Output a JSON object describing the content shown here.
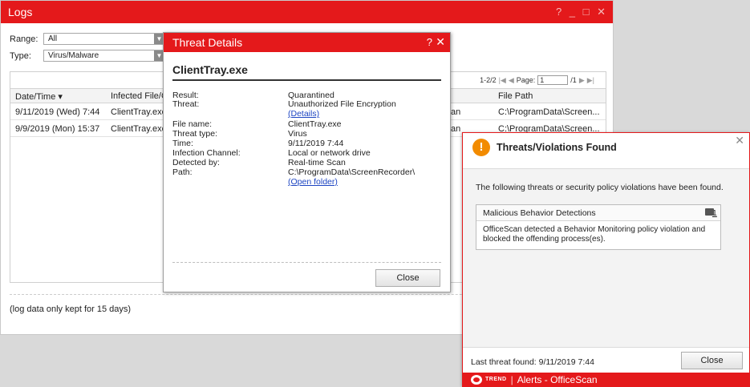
{
  "logs": {
    "title": "Logs",
    "window_controls": "? _ □ ✕",
    "range_label": "Range:",
    "range_value": "All",
    "type_label": "Type:",
    "type_value": "Virus/Malware",
    "pager": {
      "summary": "1-2/2",
      "first": "|◀",
      "prev": "◀",
      "page_label": "Page:",
      "page_value": "1",
      "total": "/1",
      "next": "▶",
      "last": "▶|"
    },
    "columns": [
      "Date/Time ▾",
      "Infected File/O",
      "an",
      "File Path"
    ],
    "rows": [
      {
        "datetime": "9/11/2019 (Wed) 7:44",
        "file": "ClientTray.exe",
        "scan": "an",
        "path": "C:\\ProgramData\\Screen..."
      },
      {
        "datetime": "9/9/2019 (Mon) 15:37",
        "file": "ClientTray.exe",
        "scan": "an",
        "path": "C:\\ProgramData\\Screen..."
      }
    ],
    "footer_note": "(log data only kept for 15 days)"
  },
  "threat_details": {
    "title": "Threat Details",
    "help": "?",
    "close_x": "✕",
    "file_name_heading": "ClientTray.exe",
    "fields": [
      {
        "key": "Result:",
        "value": "Quarantined"
      },
      {
        "key": "Threat:",
        "value": "Unauthorized File Encryption"
      },
      {
        "key": "",
        "value": "(Details)"
      },
      {
        "key": "File name:",
        "value": "ClientTray.exe"
      },
      {
        "key": "Threat type:",
        "value": "Virus"
      },
      {
        "key": "Time:",
        "value": "9/11/2019 7:44"
      },
      {
        "key": "Infection Channel:",
        "value": "Local or network drive"
      },
      {
        "key": "Detected by:",
        "value": "Real-time Scan"
      },
      {
        "key": "Path:",
        "value": "C:\\ProgramData\\ScreenRecorder\\"
      },
      {
        "key": "",
        "value": "(Open folder)"
      }
    ],
    "close_label": "Close"
  },
  "alerts": {
    "title": "Threats/Violations Found",
    "close_x": "✕",
    "message": "The following threats or security policy violations have been found.",
    "card": {
      "name": "Malicious Behavior Detections",
      "count": "1",
      "description": "OfficeScan detected a Behavior Monitoring policy violation and blocked the offending process(es)."
    },
    "last_found": "Last threat found: 9/11/2019 7:44",
    "close_label": "Close",
    "brand_trend": "TREND",
    "brand_sep": "|",
    "brand_text": "Alerts - OfficeScan"
  },
  "colors": {
    "accent": "#e4191b",
    "warning": "#f28b00",
    "link": "#1c44c2"
  }
}
